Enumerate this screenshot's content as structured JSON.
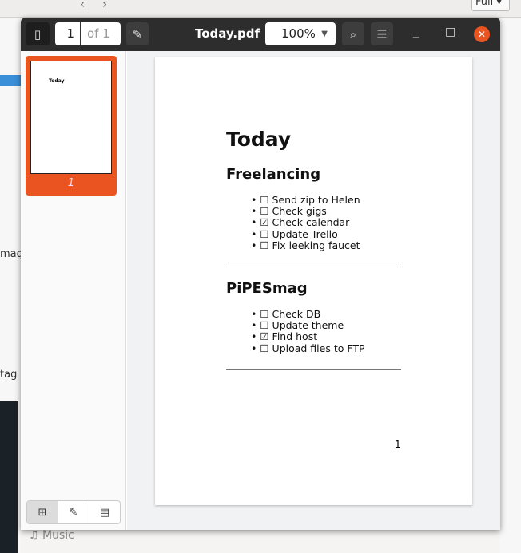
{
  "background": {
    "zoom_select": "Full",
    "left_labels": [
      "mag",
      "tag"
    ],
    "music_label": "Music"
  },
  "header": {
    "page_current": "1",
    "page_of": "of 1",
    "title": "Today.pdf",
    "zoom": "100%"
  },
  "thumbnail": {
    "page_number": "1"
  },
  "document": {
    "title": "Today",
    "sections": [
      {
        "heading": "Freelancing",
        "items": [
          "☐ Send zip to Helen",
          "☐ Check gigs",
          "☑ Check calendar",
          "☐ Update Trello",
          "☐ Fix leeking faucet"
        ]
      },
      {
        "heading": "PiPESmag",
        "items": [
          "☐ Check DB",
          "☐ Update theme",
          "☑ Find host",
          "☐ Upload files to FTP"
        ]
      }
    ],
    "page_number": "1"
  },
  "colors": {
    "accent": "#e95420",
    "header": "#2d2d2d"
  }
}
